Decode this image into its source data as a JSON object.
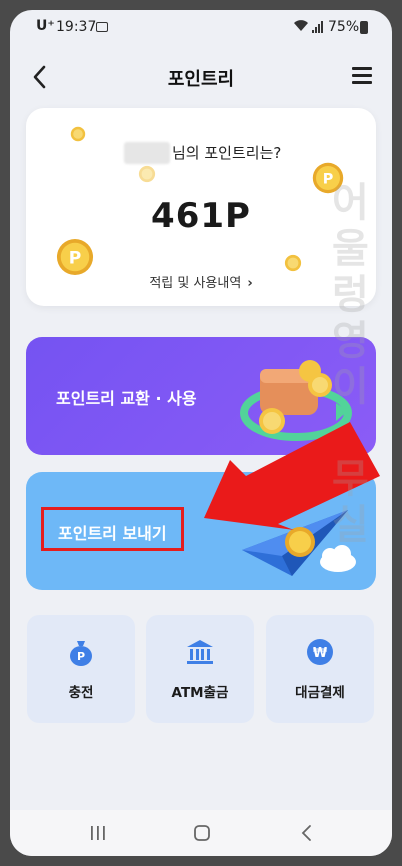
{
  "status_bar": {
    "carrier": "U⁺",
    "time": "19:37",
    "battery": "75%",
    "icons": [
      "image-icon",
      "wifi-icon",
      "signal-icon",
      "battery-icon"
    ]
  },
  "header": {
    "title": "포인트리",
    "back_icon": "chevron-left-icon",
    "menu_icon": "hamburger-menu-icon"
  },
  "point_card": {
    "question": "님의 포인트리는?",
    "value": "461P",
    "history_link": "적립 및 사용내역",
    "history_chevron": "›"
  },
  "exchange_card": {
    "label": "포인트리 교환 · 사용",
    "bg_color": "#7553f2"
  },
  "send_card": {
    "label": "포인트리 보내기",
    "bg_color": "#6eb8f7",
    "highlight_color": "#e51d1d"
  },
  "quick_actions": [
    {
      "label": "충전",
      "icon": "money-bag-icon"
    },
    {
      "label": "ATM출금",
      "icon": "bank-icon"
    },
    {
      "label": "대금결제",
      "icon": "won-coin-icon"
    }
  ],
  "navbar": {
    "icons": [
      "recent-apps-icon",
      "home-icon",
      "back-icon"
    ]
  },
  "colors": {
    "accent_blue": "#3f7fe6",
    "coin_yellow": "#f5c542",
    "arrow_red": "#ea1a1a"
  }
}
